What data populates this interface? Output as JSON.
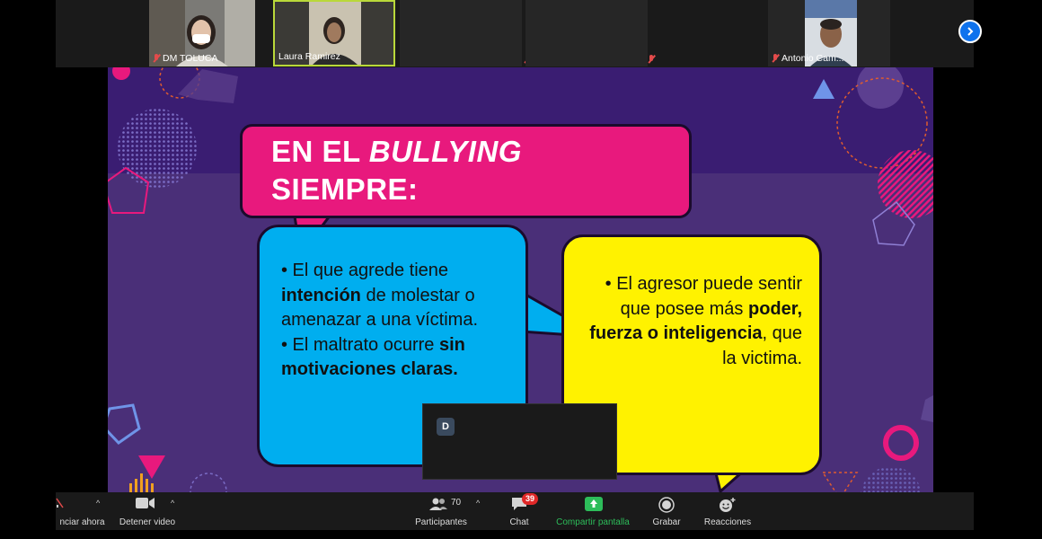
{
  "participants_strip": [
    {
      "name": "DM TOLUCA",
      "muted": true
    },
    {
      "name": "Laura Ramirez",
      "muted": false,
      "active_speaker": true
    },
    {
      "name": "",
      "muted": true
    },
    {
      "name": "",
      "muted": true
    },
    {
      "name": "Antonio Cam...",
      "muted": true
    }
  ],
  "slide": {
    "title_line1_prefix": "EN EL ",
    "title_line1_italic": "BULLYING",
    "title_line2": "SIEMPRE:",
    "blue_bubble": {
      "p1_a": "• El que agrede tiene ",
      "p1_bold": "intención",
      "p1_b": " de molestar o amenazar a una víctima.",
      "p2_a": "• El maltrato ocurre ",
      "p2_bold": "sin motivaciones claras."
    },
    "yellow_bubble": {
      "a": "• El agresor puede sentir que posee más ",
      "bold": "poder, fuerza o inteligencia",
      "b": ", que la victima."
    }
  },
  "chat_popup": {
    "avatar_letter": "D"
  },
  "toolbar": {
    "start_audio_label": "nciar ahora",
    "stop_video_label": "Detener video",
    "participants_label": "Participantes",
    "participants_count": "70",
    "chat_label": "Chat",
    "chat_badge": "39",
    "share_label": "Compartir pantalla",
    "record_label": "Grabar",
    "reactions_label": "Reacciones"
  },
  "colors": {
    "accent_blue": "#0e72ed",
    "share_green": "#2dbd5a",
    "badge_red": "#e02828",
    "slide_pink": "#e8197d",
    "slide_cyan": "#00aeef",
    "slide_yellow": "#fff200"
  }
}
